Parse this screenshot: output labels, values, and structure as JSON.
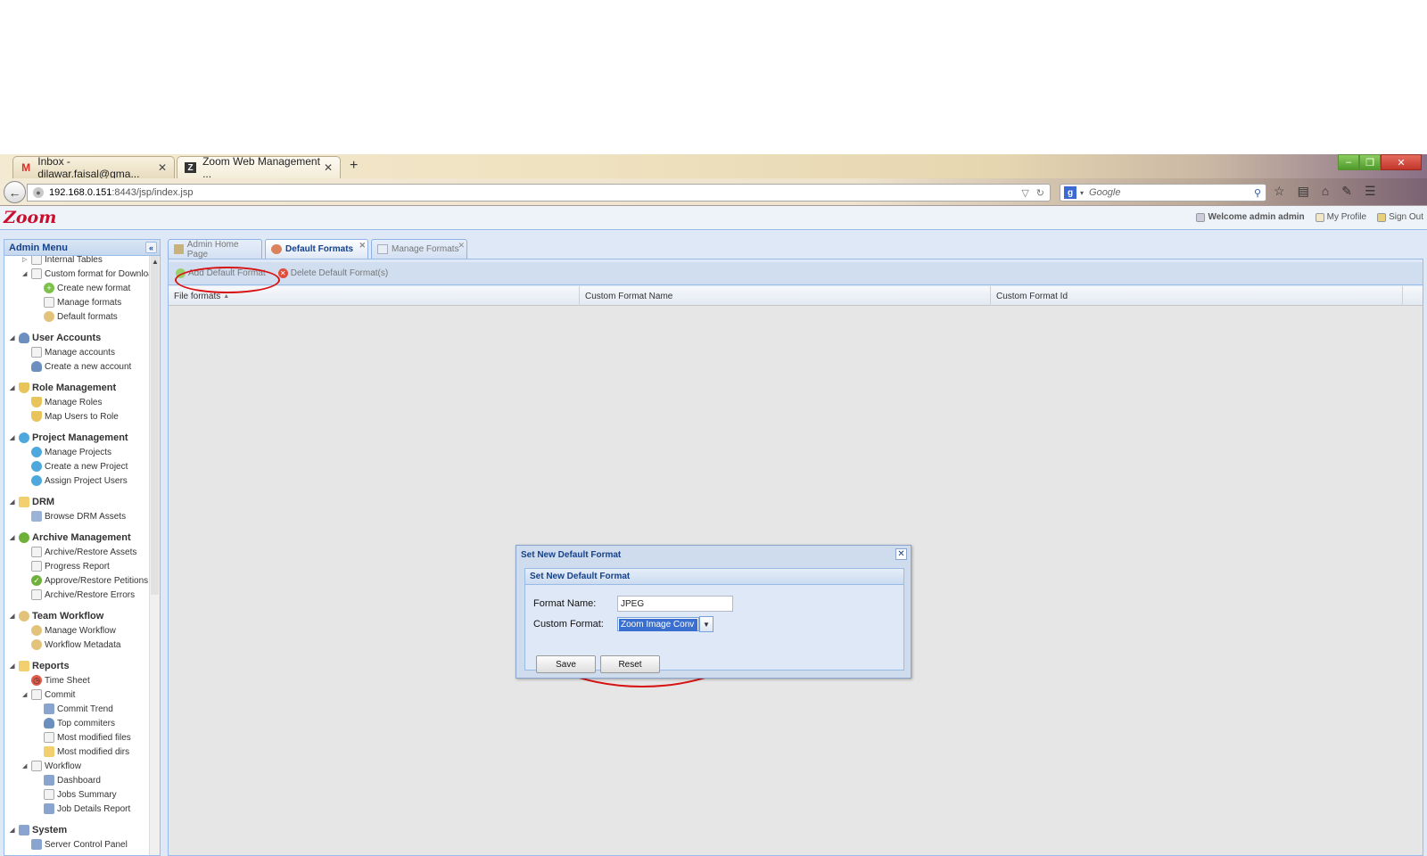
{
  "browser": {
    "tabs": [
      {
        "label": "Inbox - dilawar.faisal@gma...",
        "icon": "gmail-icon"
      },
      {
        "label": "Zoom Web Management ...",
        "icon": "zoom-icon"
      }
    ],
    "url_host": "192.168.0.151",
    "url_rest": ":8443/jsp/index.jsp",
    "search_placeholder": "Google"
  },
  "app": {
    "logo": "Zoom",
    "user": {
      "welcome": "Welcome admin admin",
      "profile": "My Profile",
      "signout": "Sign Out"
    }
  },
  "admin_menu": {
    "title": "Admin Menu",
    "items": [
      {
        "label": "Internal Tables",
        "level": 1,
        "icon": "page-icon"
      },
      {
        "label": "Custom format for Downloa",
        "level": 1,
        "icon": "page-icon"
      },
      {
        "label": "Create new format",
        "level": 2,
        "icon": "add-icon"
      },
      {
        "label": "Manage formats",
        "level": 2,
        "icon": "page-icon"
      },
      {
        "label": "Default formats",
        "level": 2,
        "icon": "gear-icon"
      },
      {
        "label": "User Accounts",
        "level": 0,
        "icon": "user-icon"
      },
      {
        "label": "Manage accounts",
        "level": 1,
        "icon": "page-icon"
      },
      {
        "label": "Create a new account",
        "level": 1,
        "icon": "user-icon"
      },
      {
        "label": "Role Management",
        "level": 0,
        "icon": "shield-icon"
      },
      {
        "label": "Manage Roles",
        "level": 1,
        "icon": "shield-icon"
      },
      {
        "label": "Map Users to Role",
        "level": 1,
        "icon": "shield-icon"
      },
      {
        "label": "Project Management",
        "level": 0,
        "icon": "globe-icon"
      },
      {
        "label": "Manage Projects",
        "level": 1,
        "icon": "globe-icon"
      },
      {
        "label": "Create a new Project",
        "level": 1,
        "icon": "globe-icon"
      },
      {
        "label": "Assign Project Users",
        "level": 1,
        "icon": "globe-icon"
      },
      {
        "label": "DRM",
        "level": 0,
        "icon": "folder-icon"
      },
      {
        "label": "Browse DRM Assets",
        "level": 1,
        "icon": "tree-icon"
      },
      {
        "label": "Archive Management",
        "level": 0,
        "icon": "archive-icon"
      },
      {
        "label": "Archive/Restore Assets",
        "level": 1,
        "icon": "page-icon"
      },
      {
        "label": "Progress Report",
        "level": 1,
        "icon": "page-icon"
      },
      {
        "label": "Approve/Restore Petitions",
        "level": 1,
        "icon": "check-icon"
      },
      {
        "label": "Archive/Restore Errors",
        "level": 1,
        "icon": "page-icon"
      },
      {
        "label": "Team Workflow",
        "level": 0,
        "icon": "gear-icon"
      },
      {
        "label": "Manage Workflow",
        "level": 1,
        "icon": "gear-icon"
      },
      {
        "label": "Workflow Metadata",
        "level": 1,
        "icon": "gear-icon"
      },
      {
        "label": "Reports",
        "level": 0,
        "icon": "folder-icon"
      },
      {
        "label": "Time Sheet",
        "level": 1,
        "icon": "clock-icon"
      },
      {
        "label": "Commit",
        "level": 1,
        "icon": "page-icon"
      },
      {
        "label": "Commit Trend",
        "level": 2,
        "icon": "chart-icon"
      },
      {
        "label": "Top commiters",
        "level": 2,
        "icon": "user-icon"
      },
      {
        "label": "Most modified files",
        "level": 2,
        "icon": "page-icon"
      },
      {
        "label": "Most modified dirs",
        "level": 2,
        "icon": "folder-icon"
      },
      {
        "label": "Workflow",
        "level": 1,
        "icon": "page-icon"
      },
      {
        "label": "Dashboard",
        "level": 2,
        "icon": "chart-icon"
      },
      {
        "label": "Jobs Summary",
        "level": 2,
        "icon": "page-icon"
      },
      {
        "label": "Job Details Report",
        "level": 2,
        "icon": "chart-icon"
      },
      {
        "label": "System",
        "level": 0,
        "icon": "computer-icon"
      },
      {
        "label": "Server Control Panel",
        "level": 1,
        "icon": "computer-icon"
      }
    ]
  },
  "main_tabs": [
    {
      "label": "Admin Home Page",
      "icon": "home-icon"
    },
    {
      "label": "Default Formats",
      "icon": "gear-icon"
    },
    {
      "label": "Manage Formats",
      "icon": "page-icon"
    }
  ],
  "toolbar": {
    "add": "Add Default Format",
    "delete": "Delete Default Format(s)"
  },
  "grid": {
    "columns": [
      "File formats",
      "Custom Format Name",
      "Custom Format Id"
    ]
  },
  "dialog": {
    "title": "Set New Default Format",
    "fieldset_title": "Set New Default Format",
    "format_name_label": "Format Name:",
    "format_name_value": "JPEG",
    "custom_format_label": "Custom Format:",
    "custom_format_value": "Zoom Image Conv",
    "save": "Save",
    "reset": "Reset"
  },
  "colors": {
    "ext_blue_header": "#15428b",
    "panel_bg": "#dfe8f6",
    "annotation_red": "#d81313",
    "logo_red": "#c8102e"
  }
}
